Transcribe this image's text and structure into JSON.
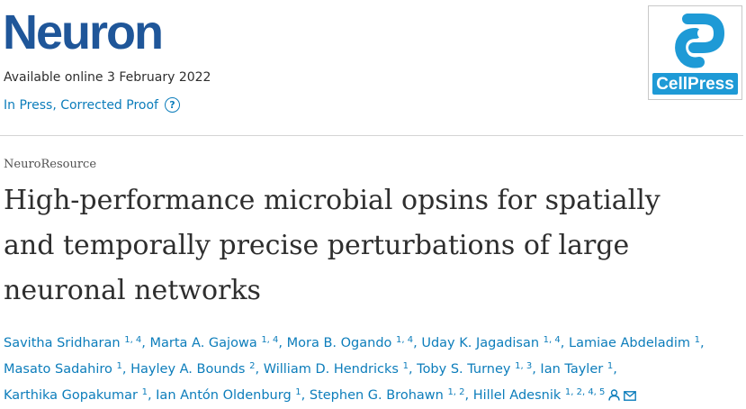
{
  "journal": {
    "title": "Neuron"
  },
  "publication": {
    "available": "Available online 3 February 2022",
    "status_links": [
      "In Press",
      "Corrected Proof"
    ],
    "status_separator": ", ",
    "help_symbol": "?"
  },
  "publisher": {
    "logo_text": "CellPress",
    "logo_color": "#1e9ad6"
  },
  "article": {
    "type": "NeuroResource",
    "title_lines": [
      "High-performance microbial opsins for spatially",
      "and temporally precise perturbations of large",
      "neuronal networks"
    ]
  },
  "authors": [
    {
      "name": "Savitha Sridharan",
      "aff": "1, 4"
    },
    {
      "name": "Marta A. Gajowa",
      "aff": "1, 4"
    },
    {
      "name": "Mora B. Ogando",
      "aff": "1, 4"
    },
    {
      "name": "Uday K. Jagadisan",
      "aff": "1, 4"
    },
    {
      "name": "Lamiae Abdeladim",
      "aff": "1"
    },
    {
      "name": "Masato Sadahiro",
      "aff": "1"
    },
    {
      "name": "Hayley A. Bounds",
      "aff": "2"
    },
    {
      "name": "William D. Hendricks",
      "aff": "1"
    },
    {
      "name": "Toby S. Turney",
      "aff": "1, 3"
    },
    {
      "name": "Ian Tayler",
      "aff": "1"
    },
    {
      "name": "Karthika Gopakumar",
      "aff": "1"
    },
    {
      "name": "Ian Antón Oldenburg",
      "aff": "1"
    },
    {
      "name": "Stephen G. Brohawn",
      "aff": "1, 2"
    },
    {
      "name": "Hillel Adesnik",
      "aff": "1, 2, 4, 5",
      "icons": [
        "person-icon",
        "envelope-icon"
      ]
    }
  ],
  "colors": {
    "journal": "#1f5699",
    "link": "#0c7dbb",
    "text": "#2e2e2e"
  }
}
